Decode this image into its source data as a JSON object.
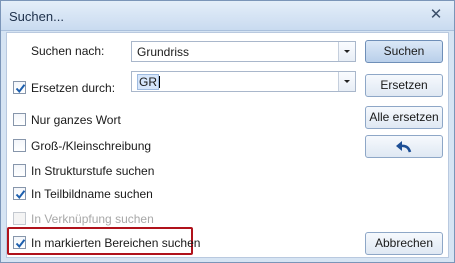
{
  "window": {
    "title": "Suchen...",
    "close_glyph": "✕"
  },
  "search": {
    "label": "Suchen nach:",
    "value": "Grundriss"
  },
  "replace": {
    "label": "Ersetzen durch:",
    "value": "GR",
    "checked": true
  },
  "buttons": {
    "search": "Suchen",
    "replace": "Ersetzen",
    "replace_all": "Alle ersetzen",
    "undo_icon": "undo-arrow-icon",
    "cancel": "Abbrechen"
  },
  "options": [
    {
      "label": "Nur ganzes Wort",
      "checked": false,
      "enabled": true
    },
    {
      "label": "Groß-/Kleinschreibung",
      "checked": false,
      "enabled": true
    },
    {
      "label": "In Strukturstufe suchen",
      "checked": false,
      "enabled": true
    },
    {
      "label": "In Teilbildname suchen",
      "checked": true,
      "enabled": true
    },
    {
      "label": "In Verknüpfung suchen",
      "checked": false,
      "enabled": false
    },
    {
      "label": "In markierten Bereichen suchen",
      "checked": true,
      "enabled": true
    }
  ],
  "colors": {
    "highlight": "#b0121b",
    "check": "#1d5fae"
  }
}
